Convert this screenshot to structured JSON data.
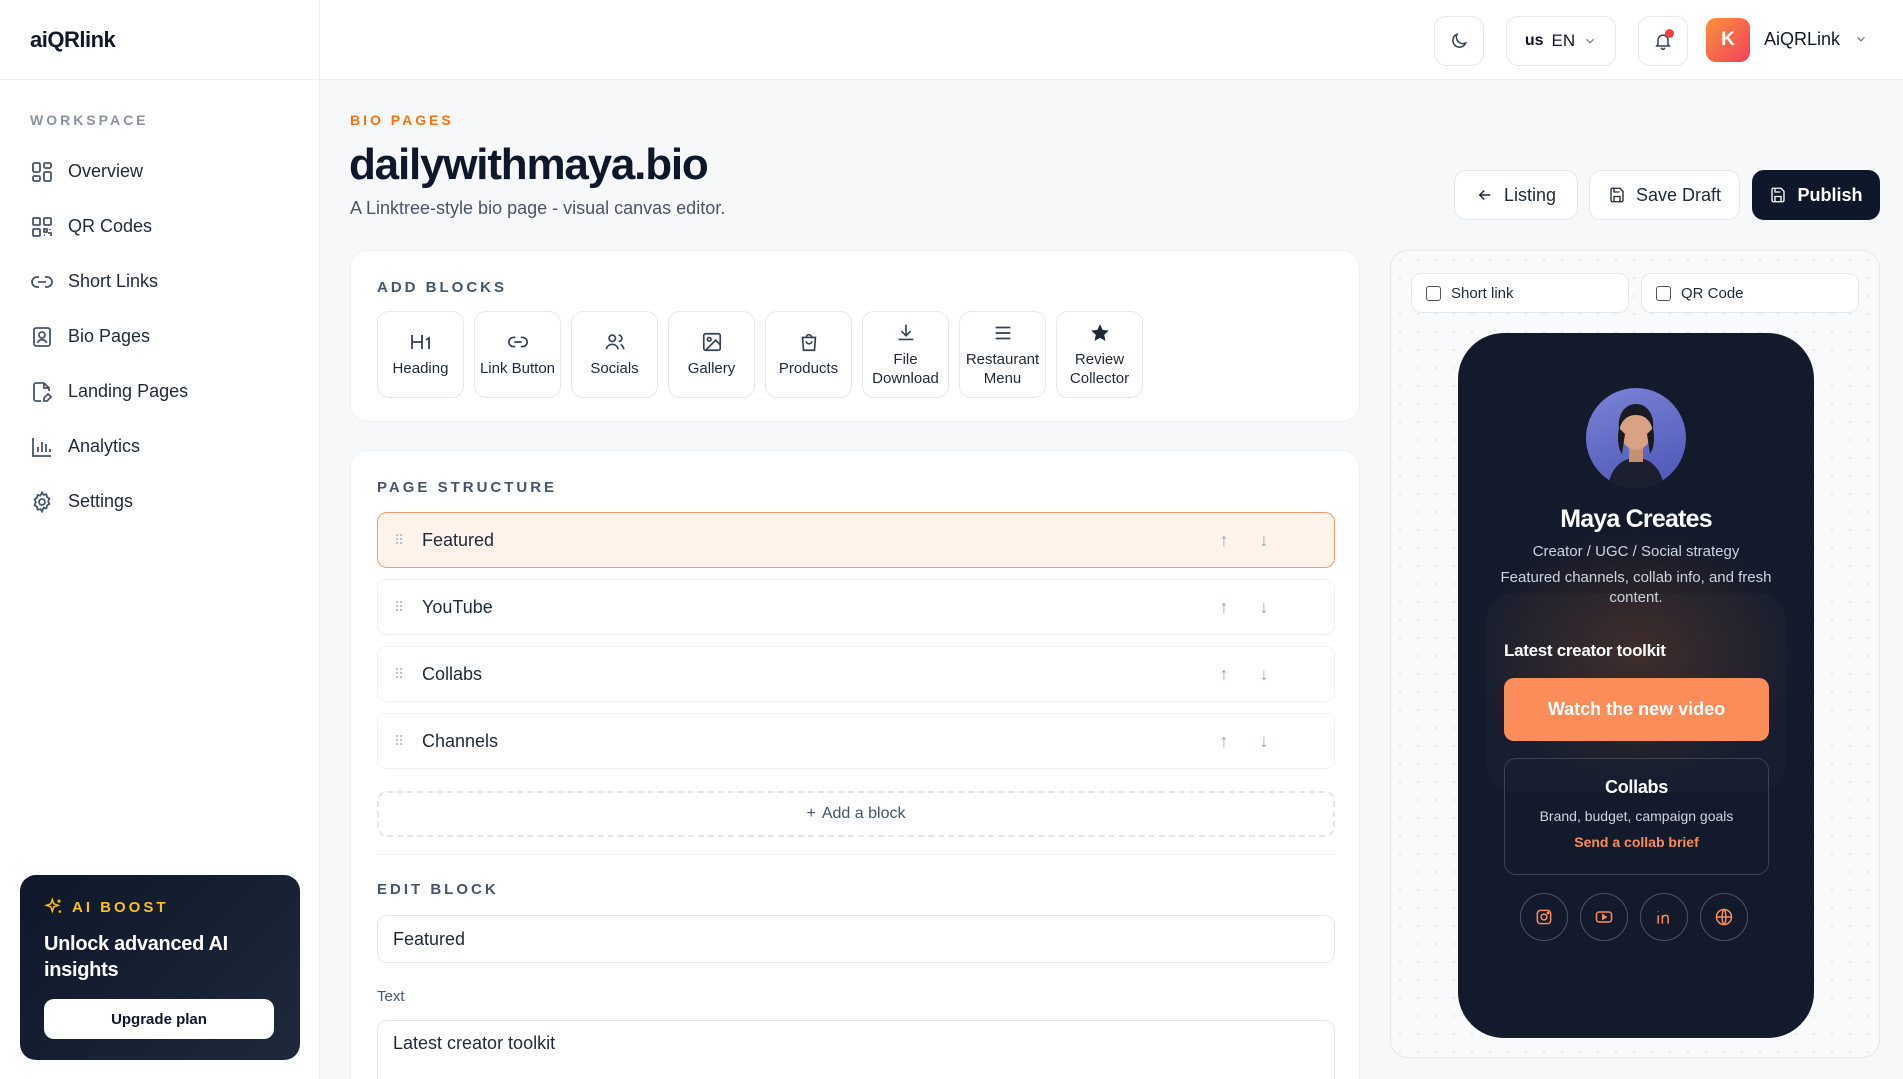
{
  "app": {
    "logo": "aiQRlink"
  },
  "sidebar": {
    "section_label": "WORKSPACE",
    "items": [
      {
        "label": "Overview",
        "icon": "grid-icon"
      },
      {
        "label": "QR Codes",
        "icon": "qr-icon"
      },
      {
        "label": "Short Links",
        "icon": "link-icon"
      },
      {
        "label": "Bio Pages",
        "icon": "profile-card-icon"
      },
      {
        "label": "Landing Pages",
        "icon": "page-icon"
      },
      {
        "label": "Analytics",
        "icon": "bar-chart-icon"
      },
      {
        "label": "Settings",
        "icon": "gear-icon"
      }
    ],
    "promo": {
      "tag": "AI BOOST",
      "title": "Unlock advanced AI insights",
      "button": "Upgrade plan"
    }
  },
  "topbar": {
    "language_flag": "us",
    "language": "EN",
    "avatar_initial": "K",
    "user_name": "AiQRLink",
    "notification_unread": true
  },
  "header": {
    "eyebrow": "BIO PAGES",
    "title": "dailywithmaya.bio",
    "subtitle": "A Linktree-style bio page - visual canvas editor.",
    "buttons": {
      "listing": "Listing",
      "save_draft": "Save Draft",
      "publish": "Publish"
    }
  },
  "add_blocks": {
    "label": "ADD BLOCKS",
    "items": [
      {
        "label": "Heading",
        "icon": "heading-icon"
      },
      {
        "label": "Link Button",
        "icon": "link-icon"
      },
      {
        "label": "Socials",
        "icon": "users-icon"
      },
      {
        "label": "Gallery",
        "icon": "image-icon"
      },
      {
        "label": "Products",
        "icon": "shopping-bag-icon"
      },
      {
        "label": "File\nDownload",
        "icon": "download-icon"
      },
      {
        "label": "Restaurant\nMenu",
        "icon": "menu-icon"
      },
      {
        "label": "Review\nCollector",
        "icon": "star-icon"
      }
    ]
  },
  "page_structure": {
    "label": "PAGE STRUCTURE",
    "rows": [
      {
        "label": "Featured",
        "active": true
      },
      {
        "label": "YouTube",
        "active": false
      },
      {
        "label": "Collabs",
        "active": false
      },
      {
        "label": "Channels",
        "active": false
      }
    ],
    "add_block": "Add a block"
  },
  "edit_block": {
    "label": "EDIT BLOCK",
    "title_value": "Featured",
    "text_label": "Text",
    "text_value": "Latest creator toolkit"
  },
  "preview": {
    "toggles": {
      "short_link": "Short link",
      "qr_code": "QR Code"
    },
    "profile": {
      "name": "Maya Creates",
      "role": "Creator / UGC / Social strategy",
      "description": "Featured channels, collab info, and fresh content."
    },
    "featured_title": "Latest creator toolkit",
    "cta": "Watch the new video",
    "collab": {
      "title": "Collabs",
      "description": "Brand, budget, campaign goals",
      "link": "Send a collab brief"
    },
    "socials": [
      "instagram-icon",
      "youtube-icon",
      "linkedin-icon",
      "globe-icon"
    ]
  },
  "colors": {
    "accent": "#f97316",
    "cta": "#fb8d5b",
    "dark": "#0f172a",
    "phone_bg": "#131a2b"
  }
}
